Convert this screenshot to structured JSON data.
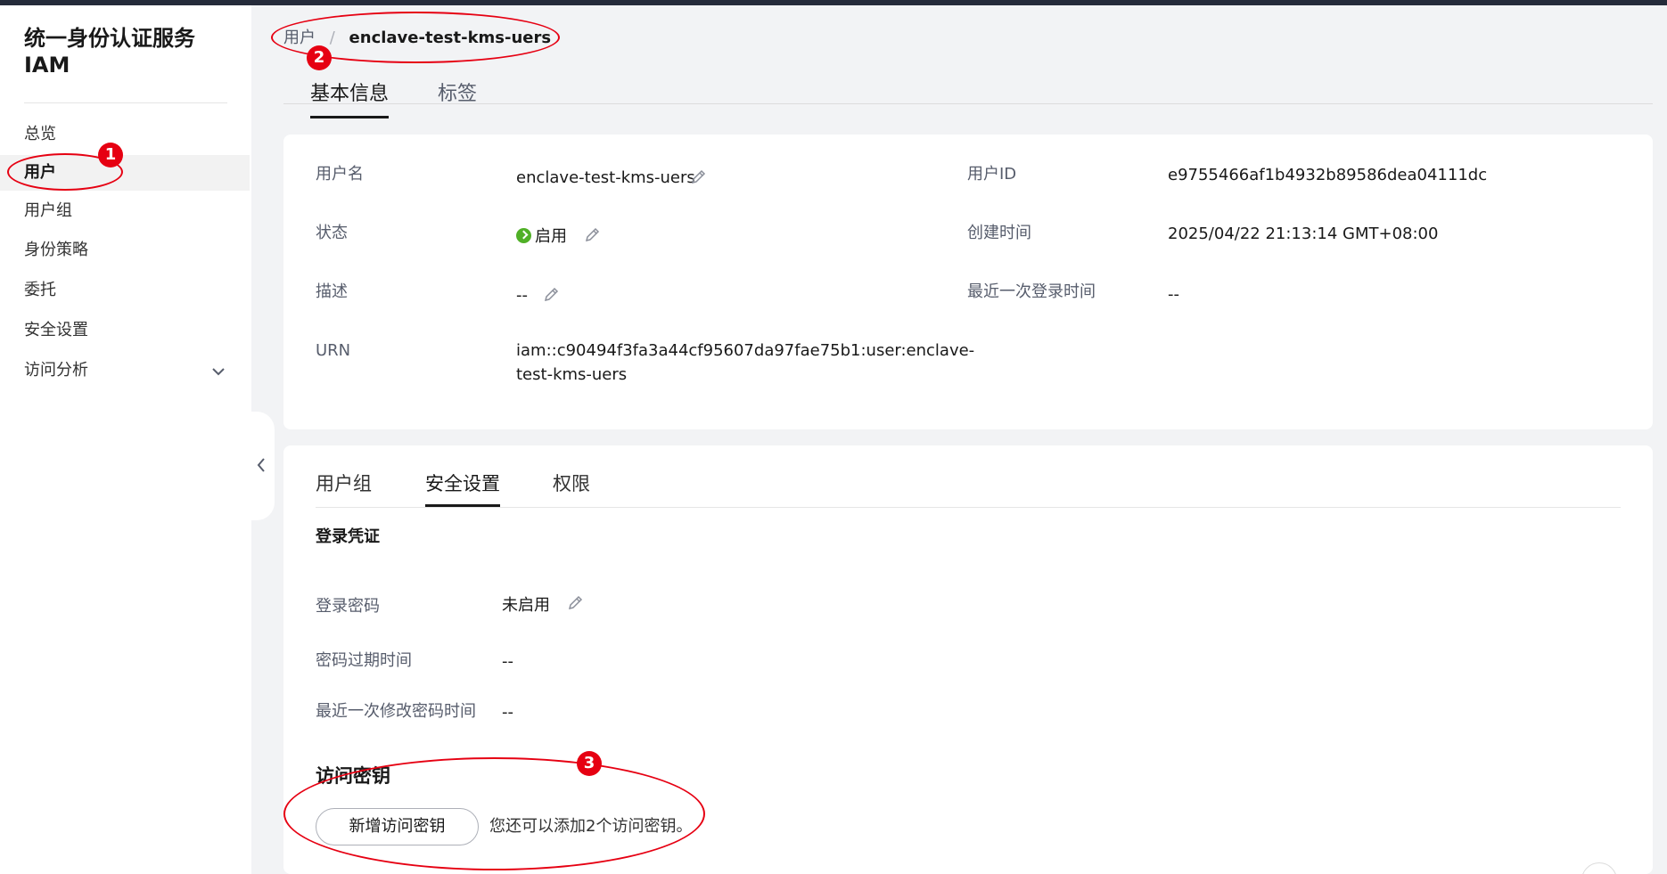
{
  "sidebar": {
    "title_line1": "统一身份认证服务",
    "title_line2": "IAM",
    "items": [
      {
        "label": "总览"
      },
      {
        "label": "用户"
      },
      {
        "label": "用户组"
      },
      {
        "label": "身份策略"
      },
      {
        "label": "委托"
      },
      {
        "label": "安全设置"
      },
      {
        "label": "访问分析"
      }
    ],
    "active_item": "用户"
  },
  "breadcrumb": {
    "parent": "用户",
    "separator": "/",
    "current": "enclave-test-kms-uers"
  },
  "top_tabs": [
    {
      "label": "基本信息",
      "active": true
    },
    {
      "label": "标签",
      "active": false
    }
  ],
  "basic_info": {
    "username_label": "用户名",
    "username_value": "enclave-test-kms-uers",
    "status_label": "状态",
    "status_value": "启用",
    "description_label": "描述",
    "description_value": "--",
    "urn_label": "URN",
    "urn_value_line1": "iam::c90494f3fa3a44cf95607da97fae75b1:user:enclave-",
    "urn_value_line2": "test-kms-uers",
    "userid_label": "用户ID",
    "userid_value": "e9755466af1b4932b89586dea04111dc",
    "created_label": "创建时间",
    "created_value": "2025/04/22 21:13:14 GMT+08:00",
    "last_login_label": "最近一次登录时间",
    "last_login_value": "--"
  },
  "detail_tabs": [
    {
      "label": "用户组",
      "active": false
    },
    {
      "label": "安全设置",
      "active": true
    },
    {
      "label": "权限",
      "active": false
    }
  ],
  "login_credentials": {
    "title": "登录凭证",
    "password_label": "登录密码",
    "password_value": "未启用",
    "expiry_label": "密码过期时间",
    "expiry_value": "--",
    "last_change_label": "最近一次修改密码时间",
    "last_change_value": "--"
  },
  "access_keys": {
    "title": "访问密钥",
    "add_button": "新增访问密钥",
    "hint": "您还可以添加2个访问密钥。"
  },
  "annotations": [
    {
      "number": "1"
    },
    {
      "number": "2"
    },
    {
      "number": "3"
    }
  ],
  "colors": {
    "annotation_red": "#e60012",
    "status_green": "#50b027",
    "page_bg": "#f2f3f5"
  }
}
